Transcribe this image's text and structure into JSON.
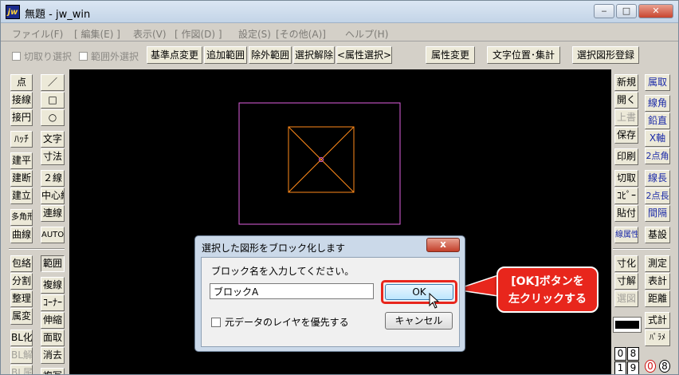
{
  "window": {
    "title": "無題 - jw_win",
    "app_icon": "jw",
    "minimize_icon": "minimize-icon",
    "minimize_glyph": "‒",
    "maximize_glyph": "□",
    "close_glyph": "✕"
  },
  "menubar": [
    "ファイル(F)",
    "[ 編集(E) ]",
    "表示(V)",
    "[ 作図(D) ]",
    "設定(S)",
    "[その他(A)]",
    "ヘルプ(H)"
  ],
  "toolbar": {
    "checks": [
      "切取り選択",
      "範囲外選択"
    ],
    "buttons": [
      "基準点変更",
      "追加範囲",
      "除外範囲",
      "選択解除",
      "<属性選択>",
      "属性変更",
      "文字位置･集計",
      "選択図形登録"
    ]
  },
  "left_col1": [
    "点",
    "接線",
    "接円",
    "ﾊｯﾁ",
    "建平",
    "建断",
    "建立",
    "多角形",
    "曲線",
    "包絡",
    "分割",
    "整理",
    "属変",
    "BL化",
    "BL解",
    "BL属"
  ],
  "left_col2": [
    "／",
    "□",
    "○",
    "文字",
    "寸法",
    "２線",
    "中心線",
    "連線",
    "AUTO",
    "範囲",
    "複線",
    "ｺｰﾅｰ",
    "伸縮",
    "面取",
    "消去",
    "複写"
  ],
  "right_col1": [
    "新規",
    "開く",
    "上書",
    "保存",
    "印刷",
    "切取",
    "ｺﾋﾟｰ",
    "貼付",
    "線属性",
    "寸化",
    "寸解",
    "選図"
  ],
  "right_col2": [
    "属取",
    "線角",
    "鉛直",
    "X軸",
    "2点角",
    "線長",
    "2点長",
    "間隔",
    "基設",
    "測定",
    "表計",
    "距離",
    "式計",
    "ﾊﾟﾗﾒ"
  ],
  "layer_numbers": [
    "0",
    "8",
    "1",
    "9",
    "0",
    "8"
  ],
  "dialog": {
    "title": "選択した図形をブロック化します",
    "close_glyph": "x",
    "prompt": "ブロック名を入力してください。",
    "block_name_value": "ブロックA",
    "ok_label": "OK",
    "checkbox_label": "元データのレイヤを優先する",
    "cancel_label": "キャンセル"
  },
  "callout": {
    "line1": "[OK]ボタンを",
    "line2": "左クリックする",
    "color": "#e8261c"
  },
  "colors": {
    "canvas": "#000000",
    "outer_rect": "#e060e0",
    "square": "#ff8a1a"
  }
}
